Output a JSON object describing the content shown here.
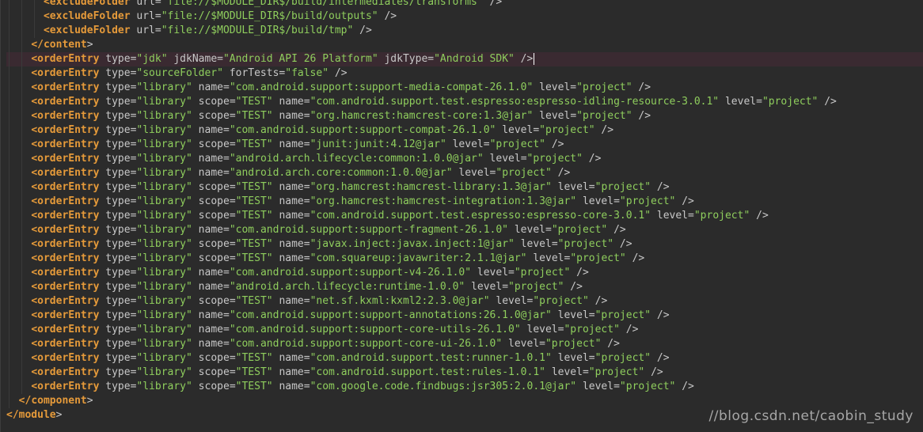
{
  "editor": {
    "lines": [
      {
        "indent": 6,
        "open": "<",
        "tag": "excludeFolder",
        "attrs": [
          {
            "n": "url",
            "v": "\"file://$MODULE_DIR$/build/intermediates/transforms\""
          }
        ],
        "close": " />"
      },
      {
        "indent": 6,
        "open": "<",
        "tag": "excludeFolder",
        "attrs": [
          {
            "n": "url",
            "v": "\"file://$MODULE_DIR$/build/outputs\""
          }
        ],
        "close": " />"
      },
      {
        "indent": 6,
        "open": "<",
        "tag": "excludeFolder",
        "attrs": [
          {
            "n": "url",
            "v": "\"file://$MODULE_DIR$/build/tmp\""
          }
        ],
        "close": " />"
      },
      {
        "indent": 4,
        "open": "</",
        "tag": "content",
        "attrs": [],
        "close": ">"
      },
      {
        "indent": 4,
        "open": "<",
        "tag": "orderEntry",
        "attrs": [
          {
            "n": "type",
            "v": "\"jdk\""
          },
          {
            "n": "jdkName",
            "v": "\"Android API 26 Platform\""
          },
          {
            "n": "jdkType",
            "v": "\"Android SDK\""
          }
        ],
        "close": " />",
        "current": true
      },
      {
        "indent": 4,
        "open": "<",
        "tag": "orderEntry",
        "attrs": [
          {
            "n": "type",
            "v": "\"sourceFolder\""
          },
          {
            "n": "forTests",
            "v": "\"false\""
          }
        ],
        "close": " />"
      },
      {
        "indent": 4,
        "open": "<",
        "tag": "orderEntry",
        "attrs": [
          {
            "n": "type",
            "v": "\"library\""
          },
          {
            "n": "name",
            "v": "\"com.android.support:support-media-compat-26.1.0\""
          },
          {
            "n": "level",
            "v": "\"project\""
          }
        ],
        "close": " />"
      },
      {
        "indent": 4,
        "open": "<",
        "tag": "orderEntry",
        "attrs": [
          {
            "n": "type",
            "v": "\"library\""
          },
          {
            "n": "scope",
            "v": "\"TEST\""
          },
          {
            "n": "name",
            "v": "\"com.android.support.test.espresso:espresso-idling-resource-3.0.1\""
          },
          {
            "n": "level",
            "v": "\"project\""
          }
        ],
        "close": " />"
      },
      {
        "indent": 4,
        "open": "<",
        "tag": "orderEntry",
        "attrs": [
          {
            "n": "type",
            "v": "\"library\""
          },
          {
            "n": "scope",
            "v": "\"TEST\""
          },
          {
            "n": "name",
            "v": "\"org.hamcrest:hamcrest-core:1.3@jar\""
          },
          {
            "n": "level",
            "v": "\"project\""
          }
        ],
        "close": " />"
      },
      {
        "indent": 4,
        "open": "<",
        "tag": "orderEntry",
        "attrs": [
          {
            "n": "type",
            "v": "\"library\""
          },
          {
            "n": "name",
            "v": "\"com.android.support:support-compat-26.1.0\""
          },
          {
            "n": "level",
            "v": "\"project\""
          }
        ],
        "close": " />"
      },
      {
        "indent": 4,
        "open": "<",
        "tag": "orderEntry",
        "attrs": [
          {
            "n": "type",
            "v": "\"library\""
          },
          {
            "n": "scope",
            "v": "\"TEST\""
          },
          {
            "n": "name",
            "v": "\"junit:junit:4.12@jar\""
          },
          {
            "n": "level",
            "v": "\"project\""
          }
        ],
        "close": " />"
      },
      {
        "indent": 4,
        "open": "<",
        "tag": "orderEntry",
        "attrs": [
          {
            "n": "type",
            "v": "\"library\""
          },
          {
            "n": "name",
            "v": "\"android.arch.lifecycle:common:1.0.0@jar\""
          },
          {
            "n": "level",
            "v": "\"project\""
          }
        ],
        "close": " />"
      },
      {
        "indent": 4,
        "open": "<",
        "tag": "orderEntry",
        "attrs": [
          {
            "n": "type",
            "v": "\"library\""
          },
          {
            "n": "name",
            "v": "\"android.arch.core:common:1.0.0@jar\""
          },
          {
            "n": "level",
            "v": "\"project\""
          }
        ],
        "close": " />"
      },
      {
        "indent": 4,
        "open": "<",
        "tag": "orderEntry",
        "attrs": [
          {
            "n": "type",
            "v": "\"library\""
          },
          {
            "n": "scope",
            "v": "\"TEST\""
          },
          {
            "n": "name",
            "v": "\"org.hamcrest:hamcrest-library:1.3@jar\""
          },
          {
            "n": "level",
            "v": "\"project\""
          }
        ],
        "close": " />"
      },
      {
        "indent": 4,
        "open": "<",
        "tag": "orderEntry",
        "attrs": [
          {
            "n": "type",
            "v": "\"library\""
          },
          {
            "n": "scope",
            "v": "\"TEST\""
          },
          {
            "n": "name",
            "v": "\"org.hamcrest:hamcrest-integration:1.3@jar\""
          },
          {
            "n": "level",
            "v": "\"project\""
          }
        ],
        "close": " />"
      },
      {
        "indent": 4,
        "open": "<",
        "tag": "orderEntry",
        "attrs": [
          {
            "n": "type",
            "v": "\"library\""
          },
          {
            "n": "scope",
            "v": "\"TEST\""
          },
          {
            "n": "name",
            "v": "\"com.android.support.test.espresso:espresso-core-3.0.1\""
          },
          {
            "n": "level",
            "v": "\"project\""
          }
        ],
        "close": " />"
      },
      {
        "indent": 4,
        "open": "<",
        "tag": "orderEntry",
        "attrs": [
          {
            "n": "type",
            "v": "\"library\""
          },
          {
            "n": "name",
            "v": "\"com.android.support:support-fragment-26.1.0\""
          },
          {
            "n": "level",
            "v": "\"project\""
          }
        ],
        "close": " />"
      },
      {
        "indent": 4,
        "open": "<",
        "tag": "orderEntry",
        "attrs": [
          {
            "n": "type",
            "v": "\"library\""
          },
          {
            "n": "scope",
            "v": "\"TEST\""
          },
          {
            "n": "name",
            "v": "\"javax.inject:javax.inject:1@jar\""
          },
          {
            "n": "level",
            "v": "\"project\""
          }
        ],
        "close": " />"
      },
      {
        "indent": 4,
        "open": "<",
        "tag": "orderEntry",
        "attrs": [
          {
            "n": "type",
            "v": "\"library\""
          },
          {
            "n": "scope",
            "v": "\"TEST\""
          },
          {
            "n": "name",
            "v": "\"com.squareup:javawriter:2.1.1@jar\""
          },
          {
            "n": "level",
            "v": "\"project\""
          }
        ],
        "close": " />"
      },
      {
        "indent": 4,
        "open": "<",
        "tag": "orderEntry",
        "attrs": [
          {
            "n": "type",
            "v": "\"library\""
          },
          {
            "n": "name",
            "v": "\"com.android.support:support-v4-26.1.0\""
          },
          {
            "n": "level",
            "v": "\"project\""
          }
        ],
        "close": " />"
      },
      {
        "indent": 4,
        "open": "<",
        "tag": "orderEntry",
        "attrs": [
          {
            "n": "type",
            "v": "\"library\""
          },
          {
            "n": "name",
            "v": "\"android.arch.lifecycle:runtime-1.0.0\""
          },
          {
            "n": "level",
            "v": "\"project\""
          }
        ],
        "close": " />"
      },
      {
        "indent": 4,
        "open": "<",
        "tag": "orderEntry",
        "attrs": [
          {
            "n": "type",
            "v": "\"library\""
          },
          {
            "n": "scope",
            "v": "\"TEST\""
          },
          {
            "n": "name",
            "v": "\"net.sf.kxml:kxml2:2.3.0@jar\""
          },
          {
            "n": "level",
            "v": "\"project\""
          }
        ],
        "close": " />"
      },
      {
        "indent": 4,
        "open": "<",
        "tag": "orderEntry",
        "attrs": [
          {
            "n": "type",
            "v": "\"library\""
          },
          {
            "n": "name",
            "v": "\"com.android.support:support-annotations:26.1.0@jar\""
          },
          {
            "n": "level",
            "v": "\"project\""
          }
        ],
        "close": " />"
      },
      {
        "indent": 4,
        "open": "<",
        "tag": "orderEntry",
        "attrs": [
          {
            "n": "type",
            "v": "\"library\""
          },
          {
            "n": "name",
            "v": "\"com.android.support:support-core-utils-26.1.0\""
          },
          {
            "n": "level",
            "v": "\"project\""
          }
        ],
        "close": " />"
      },
      {
        "indent": 4,
        "open": "<",
        "tag": "orderEntry",
        "attrs": [
          {
            "n": "type",
            "v": "\"library\""
          },
          {
            "n": "name",
            "v": "\"com.android.support:support-core-ui-26.1.0\""
          },
          {
            "n": "level",
            "v": "\"project\""
          }
        ],
        "close": " />"
      },
      {
        "indent": 4,
        "open": "<",
        "tag": "orderEntry",
        "attrs": [
          {
            "n": "type",
            "v": "\"library\""
          },
          {
            "n": "scope",
            "v": "\"TEST\""
          },
          {
            "n": "name",
            "v": "\"com.android.support.test:runner-1.0.1\""
          },
          {
            "n": "level",
            "v": "\"project\""
          }
        ],
        "close": " />"
      },
      {
        "indent": 4,
        "open": "<",
        "tag": "orderEntry",
        "attrs": [
          {
            "n": "type",
            "v": "\"library\""
          },
          {
            "n": "scope",
            "v": "\"TEST\""
          },
          {
            "n": "name",
            "v": "\"com.android.support.test:rules-1.0.1\""
          },
          {
            "n": "level",
            "v": "\"project\""
          }
        ],
        "close": " />"
      },
      {
        "indent": 4,
        "open": "<",
        "tag": "orderEntry",
        "attrs": [
          {
            "n": "type",
            "v": "\"library\""
          },
          {
            "n": "scope",
            "v": "\"TEST\""
          },
          {
            "n": "name",
            "v": "\"com.google.code.findbugs:jsr305:2.0.1@jar\""
          },
          {
            "n": "level",
            "v": "\"project\""
          }
        ],
        "close": " />"
      },
      {
        "indent": 2,
        "open": "</",
        "tag": "component",
        "attrs": [],
        "close": ">"
      },
      {
        "indent": 0,
        "open": "</",
        "tag": "module",
        "attrs": [],
        "close": ">"
      }
    ]
  },
  "watermark": "//blog.csdn.net/caobin_study",
  "colors": {
    "background": "#2b2b2b",
    "tag": "#e59a3a",
    "attribute": "#c8c8c8",
    "value": "#8fce5d",
    "current_line": "#3a2a31"
  }
}
